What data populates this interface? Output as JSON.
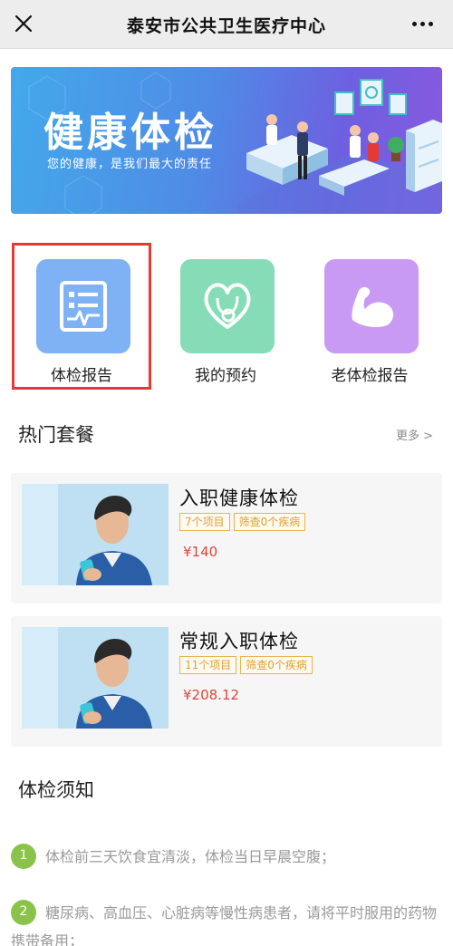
{
  "header": {
    "title": "泰安市公共卫生医疗中心",
    "close_icon": "close-icon",
    "more_icon": "more-horizontal-icon"
  },
  "banner": {
    "title": "健康体检",
    "subtitle": "您的健康，是我们最大的责任",
    "colors": {
      "start": "#43a9ea",
      "end": "#8a58df"
    }
  },
  "actions": [
    {
      "label": "体检报告",
      "icon": "report-monitor-icon",
      "color": "#7fb2f4",
      "selected": true
    },
    {
      "label": "我的预约",
      "icon": "heart-stethoscope-icon",
      "color": "#86dcb6",
      "selected": false
    },
    {
      "label": "老体检报告",
      "icon": "muscle-arm-icon",
      "color": "#c99af3",
      "selected": false
    }
  ],
  "hot_packages": {
    "title": "热门套餐",
    "more": "更多 >",
    "items": [
      {
        "name": "入职健康体检",
        "tags": [
          "7个项目",
          "筛查0个疾病"
        ],
        "price": "¥140"
      },
      {
        "name": "常规入职体检",
        "tags": [
          "11个项目",
          "筛查0个疾病"
        ],
        "price": "¥208.12"
      }
    ]
  },
  "notice": {
    "title": "体检须知",
    "items": [
      {
        "num": "1",
        "text": "体检前三天饮食宜清淡，体检当日早晨空腹；"
      },
      {
        "num": "2",
        "text": "糖尿病、高血压、心脏病等慢性病患者，请将平时服用的药物携带备用；"
      }
    ]
  },
  "colors": {
    "accent_red": "#e53935",
    "price": "#e0463a",
    "tag": "#e0a030",
    "notice_badge": "#8bc34a"
  }
}
